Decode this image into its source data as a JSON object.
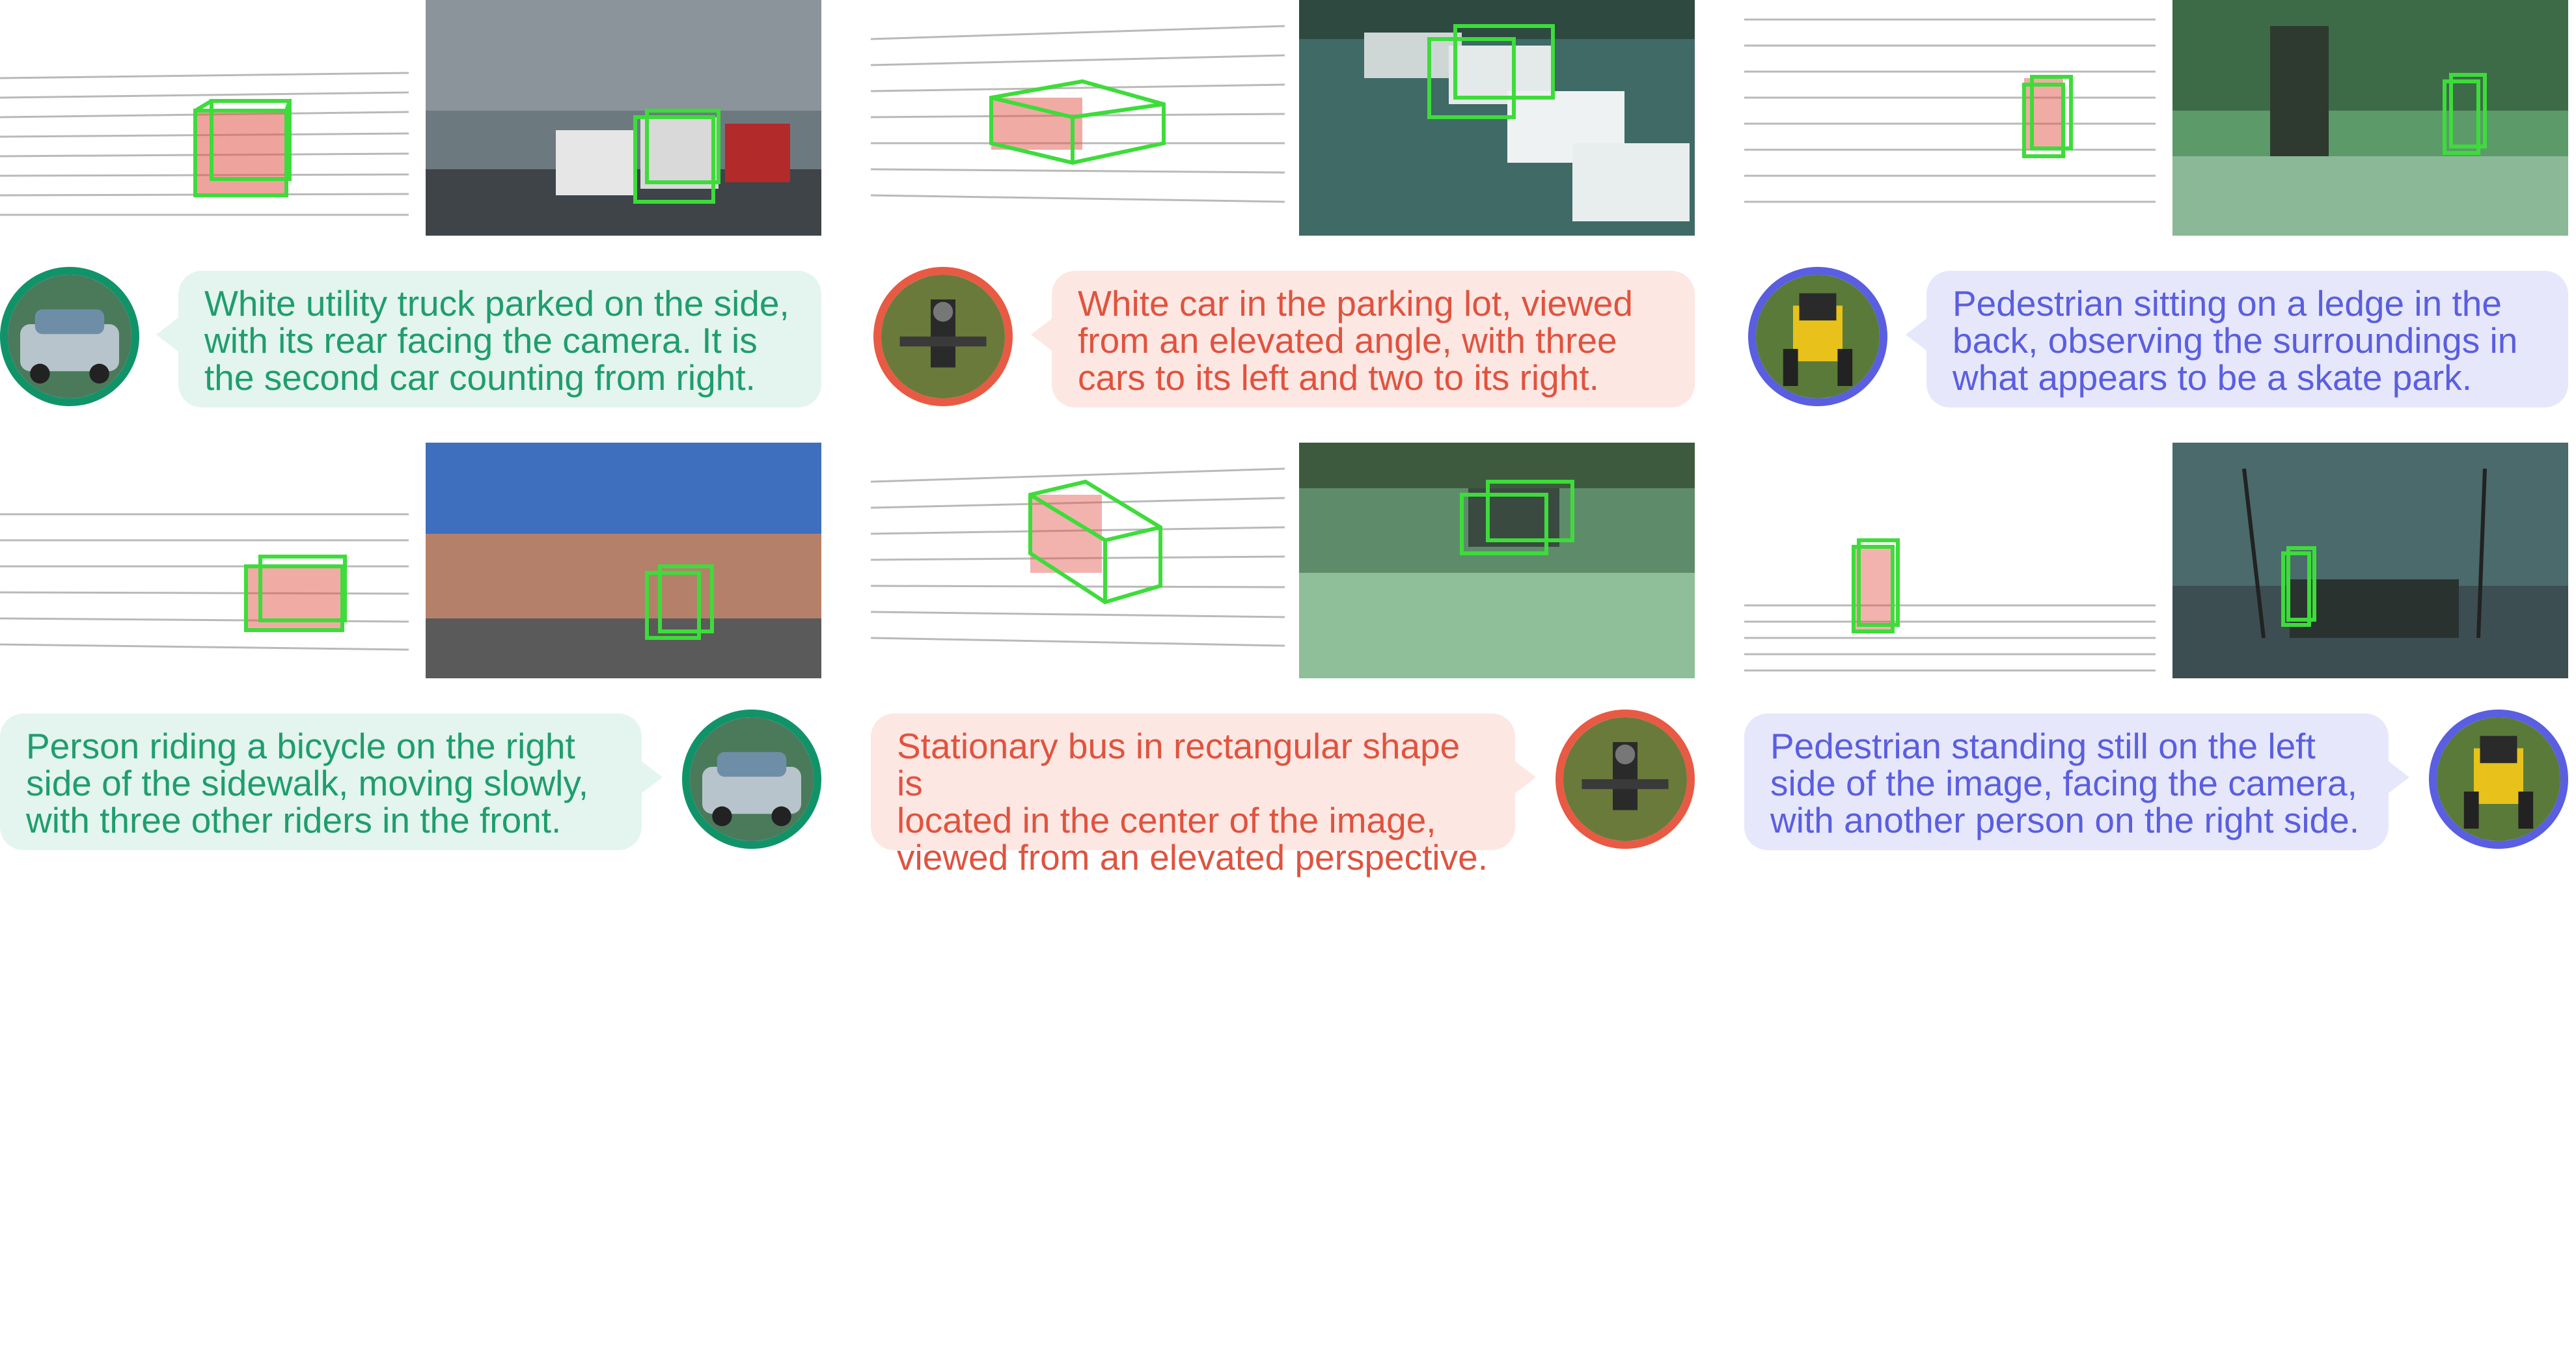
{
  "theme": {
    "car": {
      "bubble_bg": "#e3f5ee",
      "text": "#1f9d6e",
      "ring": "#11936a"
    },
    "drone": {
      "bubble_bg": "#fde7e2",
      "text": "#e0533f",
      "ring": "#e85a44"
    },
    "legged": {
      "bubble_bg": "#e6e7fb",
      "text": "#5a5ee0",
      "ring": "#5a5ee0"
    },
    "box_color": "#3ddc3a",
    "points_highlight": "#e2574c"
  },
  "platforms": {
    "car": {
      "icon": "car-icon"
    },
    "drone": {
      "icon": "drone-icon"
    },
    "legged": {
      "icon": "robot-dog-icon"
    }
  },
  "captions": [
    {
      "platform": "car",
      "text": "White utility truck parked on the side,\nwith its rear facing the camera. It is\nthe second car counting from right."
    },
    {
      "platform": "drone",
      "text": "White car in the parking lot, viewed\nfrom an elevated angle, with three\ncars to its left and two to its right."
    },
    {
      "platform": "legged",
      "text": "Pedestrian sitting on a ledge in the\nback, observing the surroundings in\nwhat appears to be a skate park."
    },
    {
      "platform": "car",
      "text": "Person riding a bicycle on the right\nside of the sidewalk, moving slowly,\nwith three other riders in the front."
    },
    {
      "platform": "drone",
      "text": "Stationary bus in rectangular shape is\nlocated in the center of the image,\nviewed from an elevated perspective."
    },
    {
      "platform": "legged",
      "text": "Pedestrian standing still on the left\nside of the image, facing the camera,\nwith another person on the right side."
    }
  ]
}
